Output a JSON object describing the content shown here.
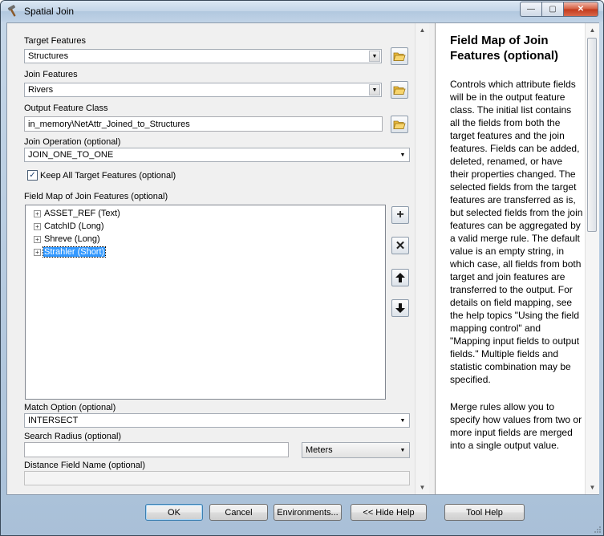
{
  "window": {
    "title": "Spatial Join",
    "controls": {
      "minimize": "—",
      "maximize": "▢",
      "close": "✕"
    }
  },
  "form": {
    "target_features": {
      "label": "Target Features",
      "value": "Structures"
    },
    "join_features": {
      "label": "Join Features",
      "value": "Rivers"
    },
    "output_feature_class": {
      "label": "Output Feature Class",
      "value": "in_memory\\NetAttr_Joined_to_Structures"
    },
    "join_operation": {
      "label": "Join Operation (optional)",
      "value": "JOIN_ONE_TO_ONE"
    },
    "keep_all": {
      "label": "Keep All Target Features (optional)",
      "checked": true
    },
    "field_map": {
      "label": "Field Map of Join Features (optional)",
      "fields": [
        {
          "text": "ASSET_REF (Text)",
          "selected": false
        },
        {
          "text": "CatchID (Long)",
          "selected": false
        },
        {
          "text": "Shreve (Long)",
          "selected": false
        },
        {
          "text": "Strahler (Short)",
          "selected": true
        }
      ]
    },
    "match_option": {
      "label": "Match Option (optional)",
      "value": "INTERSECT"
    },
    "search_radius": {
      "label": "Search Radius (optional)",
      "value": "",
      "unit": "Meters"
    },
    "distance_field": {
      "label": "Distance Field Name (optional)",
      "value": ""
    }
  },
  "help": {
    "title": "Field Map of Join Features (optional)",
    "paragraphs": [
      "Controls which attribute fields will be in the output feature class. The initial list contains all the fields from both the target features and the join features. Fields can be added, deleted, renamed, or have their properties changed. The selected fields from the target features are transferred as is, but selected fields from the join features can be aggregated by a valid merge rule. The default value is an empty string, in which case, all fields from both target and join features are transferred to the output. For details on field mapping, see the help topics \"Using the field mapping control\" and \"Mapping input fields to output fields.\" Multiple fields and statistic combination may be specified.",
      "Merge rules allow you to specify how values from two or more input fields are merged into a single output value."
    ]
  },
  "buttons": {
    "ok": "OK",
    "cancel": "Cancel",
    "environments": "Environments...",
    "hide_help": "<< Hide Help",
    "tool_help": "Tool Help"
  }
}
